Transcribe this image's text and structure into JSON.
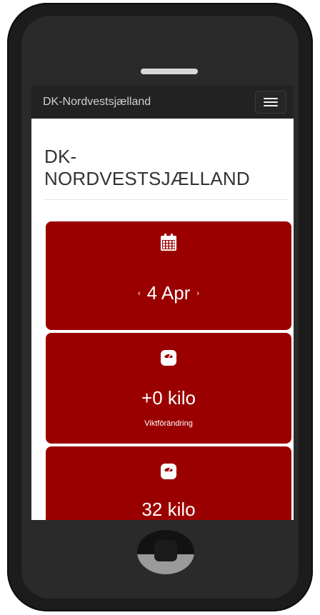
{
  "app": {
    "brand": "DK-Nordvestsjælland",
    "page_title_line1": "DK-",
    "page_title_line2": "NORDVESTSJÆLLAND"
  },
  "navbar": {
    "menu_icon": "hamburger-menu-icon"
  },
  "cards": {
    "date": {
      "icon": "calendar-icon",
      "prev_arrow": "‹",
      "value": "4 Apr",
      "next_arrow": "›"
    },
    "weight_change": {
      "icon": "scale-icon",
      "value": "+0 kilo",
      "label": "Viktförändring"
    },
    "total_weight": {
      "icon": "scale-icon",
      "value": "32 kilo"
    }
  },
  "colors": {
    "accent": "#9b0000",
    "navbar": "#222222",
    "phone_frame": "#1c1c1c"
  }
}
